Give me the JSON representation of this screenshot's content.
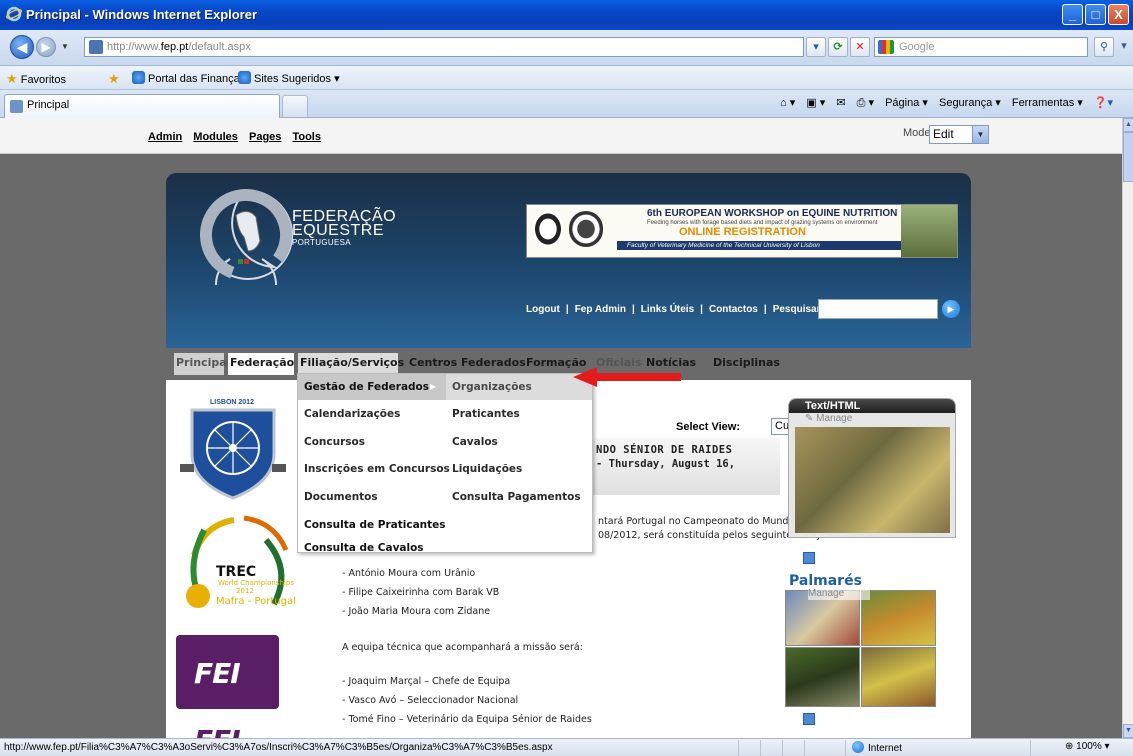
{
  "window": {
    "title": "Principal - Windows Internet Explorer",
    "controls": {
      "minimize": "_",
      "maximize": "□",
      "close": "X"
    }
  },
  "addressbar": {
    "url_prefix": "http://www.",
    "url_domain": "fep.pt",
    "url_suffix": "/default.aspx",
    "search_placeholder": "Google"
  },
  "favorites_bar": {
    "favorites_label": "Favoritos",
    "items": [
      "Portal das Finanças",
      "Sites Sugeridos ▾"
    ]
  },
  "tabs": {
    "active_label": "Principal"
  },
  "command_bar": {
    "items": [
      "Página ▾",
      "Segurança ▾",
      "Ferramentas ▾"
    ]
  },
  "control_panel": {
    "links": [
      "Admin",
      "Modules",
      "Pages",
      "Tools"
    ],
    "mode_label": "Mode",
    "mode_value": "Edit"
  },
  "header": {
    "brand_line1": "FEDERAÇÃO",
    "brand_line2": "EQUESTRE",
    "brand_line3": "PORTUGUESA",
    "banner": {
      "title": "6th EUROPEAN WORKSHOP on EQUINE NUTRITION",
      "subtitle": "Feeding horses with forage based diets and impact of grazing systems on environment",
      "cta": "ONLINE REGISTRATION",
      "faculty": "Faculty of Veterinary Medicine of the Technical University of Lisbon"
    },
    "links": [
      "Logout",
      "Fep Admin",
      "Links Úteis",
      "Contactos",
      "Pesquisar:"
    ]
  },
  "main_menu": {
    "items": [
      "Principal",
      "Federação",
      "Filiação/Serviços",
      "Centros Federados",
      "Formação",
      "Oficiais",
      "Notícias",
      "Disciplinas"
    ]
  },
  "dropdown": {
    "col1": [
      "Gestão de Federados",
      "Calendarizações",
      "Concursos",
      "Inscrições em Concursos",
      "Documentos",
      "Consulta de Praticantes",
      "Consulta de Cavalos"
    ],
    "col2": [
      "Organizações",
      "Praticantes",
      "Cavalos",
      "Liquidações",
      "Consulta Pagamentos"
    ]
  },
  "content": {
    "lisbon_label": "LISBON 2012",
    "trec_label": "TREC",
    "trec_sub1": "World Championships",
    "trec_sub2": "2012",
    "trec_sub3": "Mafra - Portugal",
    "fei_label": "FEI",
    "select_view_label": "Select View:",
    "select_view_value": "Current",
    "news_title_l1": "NDO SÉNIOR DE RAIDES",
    "news_title_l2": "- Thursday, August 16,",
    "paragraph1_l1": "ntará Portugal no Campeonato do Mundo de Raides, a realizar em",
    "paragraph1_l2": "08/2012, será constituída pelos seguintes conjuntos:",
    "riders": [
      "- António Moura com Urânio",
      "- Filipe Caixeirinha com Barak VB",
      "- João Maria Moura com Zidane"
    ],
    "team_intro": "A equipa técnica que acompanhará a missão será:",
    "staff": [
      "- Joaquim Marçal – Chefe de Equipa",
      "- Vasco Avó – Seleccionador Nacional",
      "- Tomé Fino – Veterinário da Equipa Sénior de Raides"
    ]
  },
  "right_column": {
    "text_module_title": "Text/HTML",
    "manage_label": "Manage",
    "palmares_title": "Palmarés",
    "palmares_manage": "Manage"
  },
  "statusbar": {
    "url": "http://www.fep.pt/Filia%C3%A7%C3%A3oServi%C3%A7os/Inscri%C3%A7%C3%B5es/Organiza%C3%A7%C3%B5es.aspx",
    "zone": "Internet",
    "zoom": "100%"
  }
}
